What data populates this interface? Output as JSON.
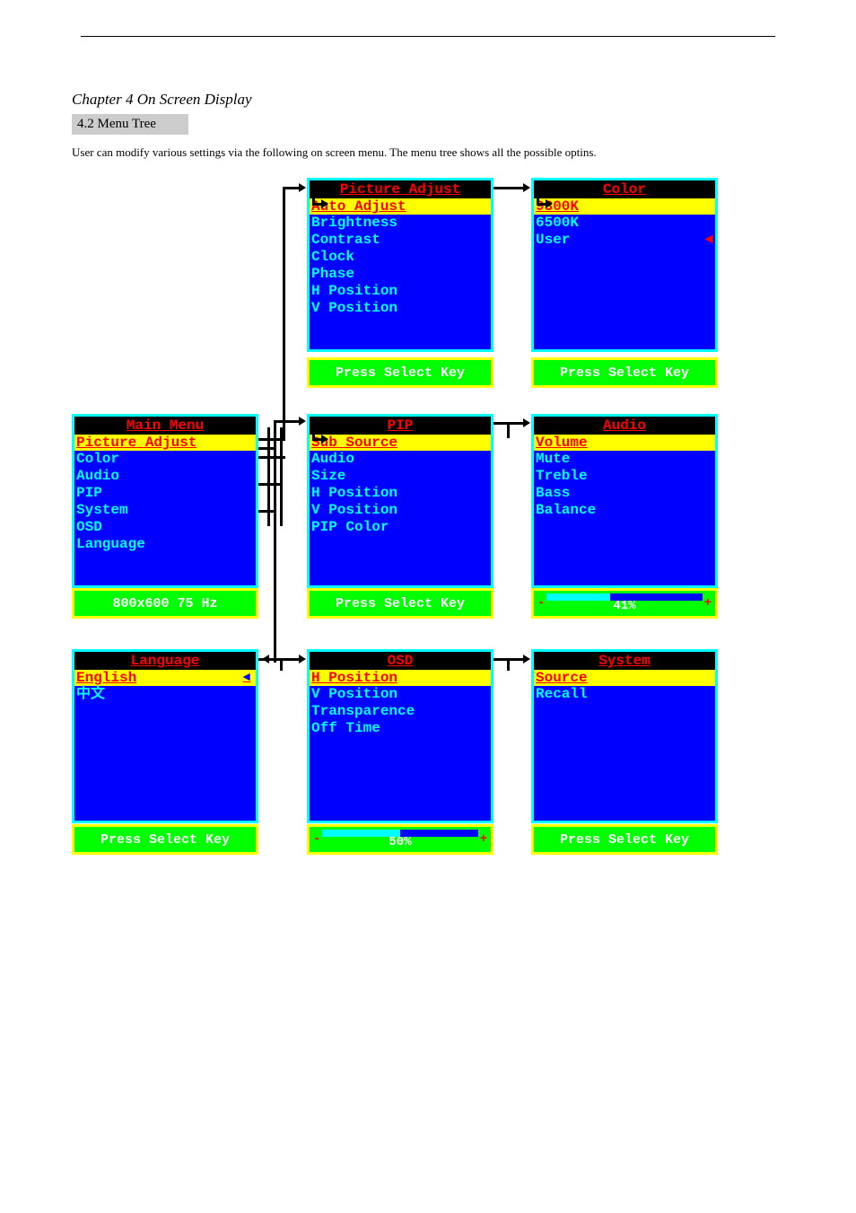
{
  "header": {
    "chapter": "Chapter 4 On Screen Display",
    "section": "4.2 Menu Tree",
    "intro": "User can modify various settings via the following on screen menu. The menu tree shows all the possible optins."
  },
  "menus": {
    "main": {
      "title": "Main Menu",
      "selected": "Picture Adjust",
      "items": [
        "Color",
        "Audio",
        "PIP",
        "System",
        "OSD",
        "Language"
      ],
      "status": "800x600  75 Hz"
    },
    "picture": {
      "title": "Picture Adjust",
      "selected": "Auto Adjust",
      "items": [
        "Brightness",
        "Contrast",
        "Clock",
        "Phase",
        "H Position",
        "V Position"
      ],
      "status": "Press Select Key"
    },
    "color": {
      "title": "Color",
      "selected": "9300K",
      "items": [
        "6500K",
        "User"
      ],
      "status": "Press Select Key"
    },
    "pip": {
      "title": "PIP",
      "selected": "Sub Source",
      "items": [
        "Audio",
        "Size",
        "H Position",
        "V Position",
        "PIP Color"
      ],
      "status": "Press Select Key"
    },
    "audio": {
      "title": "Audio",
      "selected": "Volume",
      "items": [
        "Mute",
        "Treble",
        "Bass",
        "Balance"
      ],
      "slider": {
        "percent": 41,
        "label": "41%"
      }
    },
    "language": {
      "title": "Language",
      "selected": "English",
      "items": [
        "中文"
      ],
      "status": "Press Select Key"
    },
    "osd": {
      "title": "OSD",
      "selected": "H Position",
      "items": [
        "V Position",
        "Transparence",
        "Off Time"
      ],
      "slider": {
        "percent": 50,
        "label": "50%"
      }
    },
    "system": {
      "title": "System",
      "selected": "Source",
      "items": [
        "Recall"
      ],
      "status": "Press Select Key"
    }
  }
}
